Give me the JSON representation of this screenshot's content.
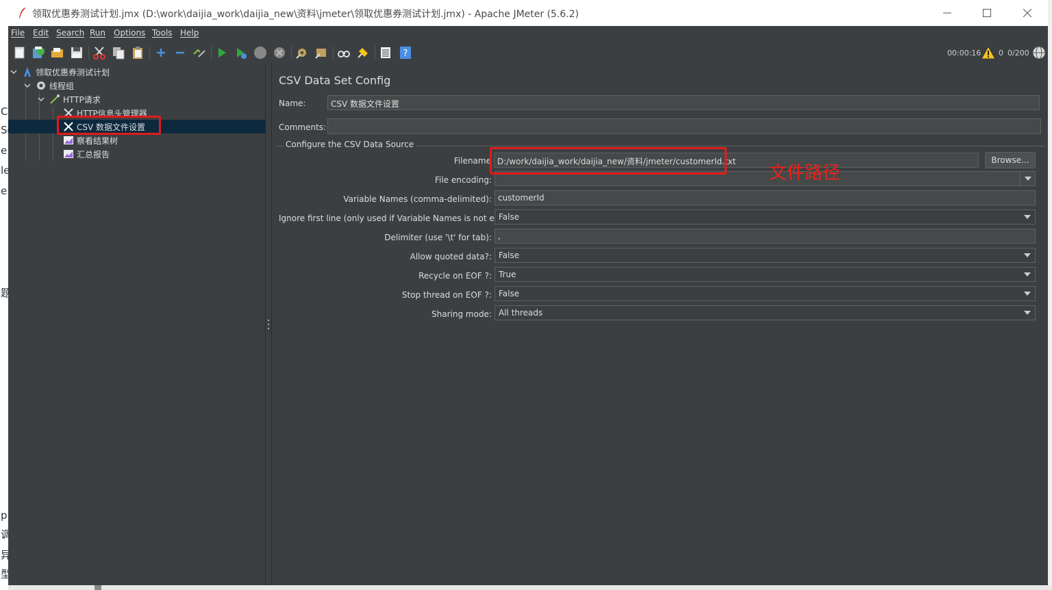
{
  "window": {
    "title": "领取优惠券测试计划.jmx (D:\\work\\daijia_work\\daijia_new\\资料\\jmeter\\领取优惠券测试计划.jmx) - Apache JMeter (5.6.2)"
  },
  "background_window": {
    "glyphs": [
      "C",
      "Se",
      "e",
      "le",
      "e",
      "题",
      "p",
      "调",
      "异",
      "型"
    ]
  },
  "menu": [
    "File",
    "Edit",
    "Search",
    "Run",
    "Options",
    "Tools",
    "Help"
  ],
  "toolbar": {
    "icons": [
      "new-icon",
      "templates-icon",
      "open-icon",
      "save-icon",
      "cut-icon",
      "copy-icon",
      "paste-icon",
      "expand-icon",
      "collapse-icon",
      "toggle-icon",
      "start-icon",
      "start-no-pause-icon",
      "stop-icon",
      "shutdown-icon",
      "clear-icon",
      "clear-all-icon",
      "search-icon",
      "reset-search-icon",
      "function-helper-icon",
      "help-icon"
    ]
  },
  "status": {
    "elapsed": "00:00:16",
    "errors": "0",
    "threads": "0/200"
  },
  "tree": {
    "root": "领取优惠券测试计划",
    "thread_group": "线程组",
    "sampler": "HTTP请求",
    "header_manager": "HTTP信息头管理器",
    "csv_config": "CSV 数据文件设置",
    "results_tree": "察看结果树",
    "summary_report": "汇总报告",
    "selected": "CSV 数据文件设置"
  },
  "panel": {
    "title": "CSV Data Set Config",
    "name_label": "Name:",
    "name_value": "CSV 数据文件设置",
    "comments_label": "Comments:",
    "comments_value": "",
    "group_title": "Configure the CSV Data Source",
    "filename_label": "Filename",
    "filename_value": "D:/work/daijia_work/daijia_new/资料/jmeter/customerId.txt",
    "browse_label": "Browse...",
    "encoding_label": "File encoding:",
    "encoding_value": "",
    "varnames_label": "Variable Names (comma-delimited):",
    "varnames_value": "customerId",
    "ignore_first_label": "Ignore first line (only used if Variable Names is not empty):",
    "ignore_first_value": "False",
    "delimiter_label": "Delimiter (use '\\t' for tab):",
    "delimiter_value": ",",
    "quoted_label": "Allow quoted data?:",
    "quoted_value": "False",
    "recycle_label": "Recycle on EOF ?:",
    "recycle_value": "True",
    "stop_thread_label": "Stop thread on EOF ?:",
    "stop_thread_value": "False",
    "sharing_label": "Sharing mode:",
    "sharing_value": "All threads"
  },
  "annotation": {
    "text": "文件路径",
    "color": "#e8231b"
  },
  "colors": {
    "background": "#3c3f41",
    "selection": "#0d293e",
    "highlight_box": "#e41a1a"
  }
}
